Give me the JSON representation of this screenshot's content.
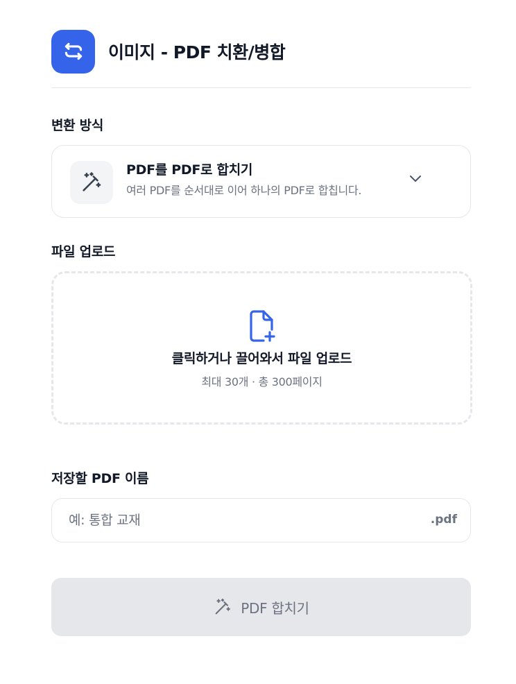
{
  "header": {
    "title": "이미지 - PDF 치환/병합",
    "icon": "repeat-arrows-icon",
    "accent_color": "#3563e9"
  },
  "method": {
    "label": "변환 방식",
    "selected_title": "PDF를 PDF로 합치기",
    "selected_description": "여러 PDF를 순서대로 이어 하나의 PDF로 합칩니다.",
    "icon": "magic-wand-icon",
    "dropdown_icon": "chevron-down-icon"
  },
  "upload": {
    "label": "파일 업로드",
    "title": "클릭하거나 끌어와서 파일 업로드",
    "limits": "최대 30개 · 총 300페이지",
    "icon": "file-plus-icon"
  },
  "filename": {
    "label": "저장할 PDF 이름",
    "placeholder": "예: 통합 교재",
    "value": "",
    "extension": ".pdf"
  },
  "submit": {
    "label": "PDF 합치기",
    "icon": "magic-wand-icon",
    "enabled": false
  }
}
